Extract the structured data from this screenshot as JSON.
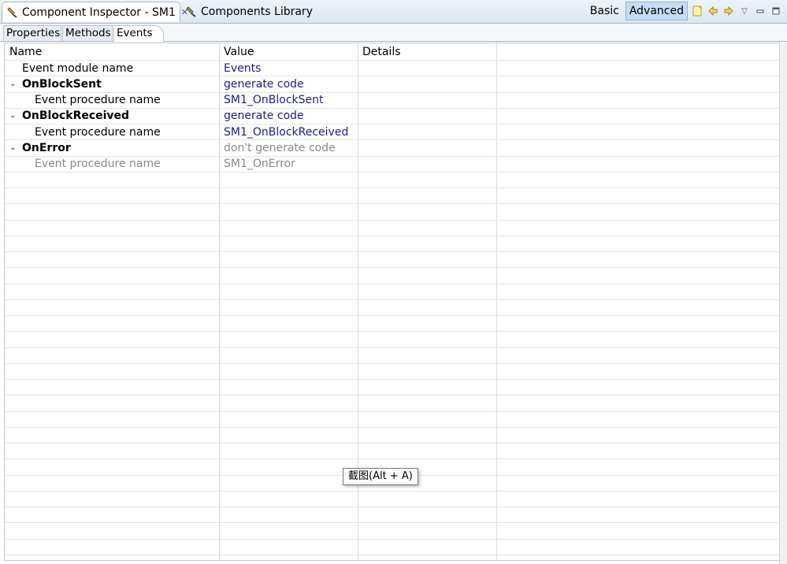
{
  "tabs": {
    "active_label": "Component Inspector - SM1",
    "inactive_label": "Components Library"
  },
  "toolbar": {
    "basic_label": "Basic",
    "advanced_label": "Advanced"
  },
  "subtabs": [
    "Properties",
    "Methods",
    "Events"
  ],
  "table": {
    "headers": [
      "Name",
      "Value",
      "Details"
    ],
    "rows": [
      {
        "name": "Event module name",
        "value": "Events"
      },
      {
        "name": "OnBlockSent",
        "value": "generate code"
      },
      {
        "name": "Event procedure name",
        "value": "SM1_OnBlockSent"
      },
      {
        "name": "OnBlockReceived",
        "value": "generate code"
      },
      {
        "name": "Event procedure name",
        "value": "SM1_OnBlockReceived"
      },
      {
        "name": "OnError",
        "value": "don't generate code"
      },
      {
        "name": "Event procedure name",
        "value": "SM1_OnError"
      }
    ]
  },
  "tooltip": "截图(Alt + A)"
}
